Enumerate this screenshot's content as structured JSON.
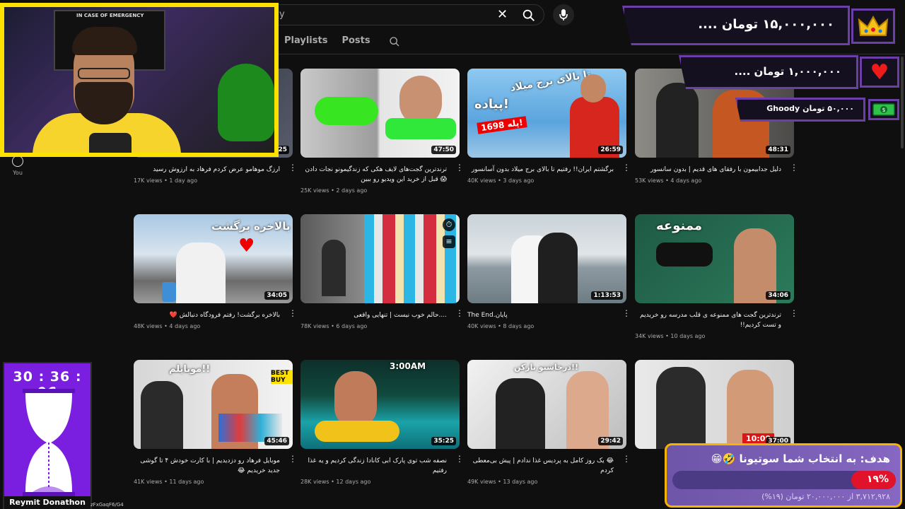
{
  "search": {
    "query": "y"
  },
  "tabs": [
    "Playlists",
    "Posts"
  ],
  "sidebar": {
    "you_label": "You"
  },
  "videos": [
    {
      "title": "ارزگ موهامو عرض کردم فرهاد به ارزوش رسید",
      "views": "17K views",
      "age": "1 day ago",
      "duration": "25",
      "rtl": true
    },
    {
      "title": "ترندترین گجت‌های لایف هکی که زندگیمونو نجات دادن 😱 قبل از خرید این ویدیو رو ببین",
      "views": "25K views",
      "age": "2 days ago",
      "duration": "47:50",
      "rtl": true
    },
    {
      "title": "برگشتم ایران!! رفتیم تا بالای برج میلاد بدون آسانسور",
      "views": "40K views",
      "age": "3 days ago",
      "duration": "26:59",
      "rtl": true
    },
    {
      "title": "دلیل جدابیمون با رفقای های قدیم | بدون سانسور",
      "views": "53K views",
      "age": "4 days ago",
      "duration": "48:31",
      "rtl": true
    },
    {
      "title": "بالاخره برگشت! رفتم فرودگاه دنبالش ❤️",
      "views": "48K views",
      "age": "4 days ago",
      "duration": "34:05",
      "rtl": true
    },
    {
      "title": "....حالم خوب نیست | تنهایی واقعی",
      "views": "78K views",
      "age": "6 days ago",
      "duration": "",
      "rtl": true
    },
    {
      "title": "The End.پایان",
      "views": "40K views",
      "age": "8 days ago",
      "duration": "1:13:53",
      "rtl": false
    },
    {
      "title": "ترندترین گجت های ممنوعه ی قلب مدرسه رو خریدیم و تست کردیم!!",
      "views": "34K views",
      "age": "10 days ago",
      "duration": "34:06",
      "rtl": true
    },
    {
      "title": "موبایل فرهاد رو دزدیدیم | با کارت خودش ۴ تا گوشی جدید خریدیم 😂",
      "views": "41K views",
      "age": "11 days ago",
      "duration": "45:46",
      "rtl": true
    },
    {
      "title": "نصفه شب توی پارک ابی کانادا زندگی کردیم و یه غذا رفتیم",
      "views": "28K views",
      "age": "12 days ago",
      "duration": "35:25",
      "rtl": true
    },
    {
      "title": "😂 یک روز کامل به پردیس غذا ندادم | پیش بی‌معطی کردم",
      "views": "49K views",
      "age": "13 days ago",
      "duration": "29:42",
      "rtl": true
    },
    {
      "title": "یه بیدار شه",
      "views": "",
      "age": "",
      "duration": "37:00",
      "rtl": true
    }
  ],
  "thumb_texts": {
    "v3_top": "تا بالای برج میلاد",
    "v3_mid": "پیاده!",
    "v3_num": "1698 پله!",
    "v5": "بالاخره برگشت",
    "v8": "ممنوعه",
    "v9_a": "موبایلم!!",
    "v9_b": "BEST BUY",
    "v10": "3:00AM",
    "v11": "درخاشنو بازکن!!",
    "v12": "10:00"
  },
  "webcam": {
    "poster_text": "IN CASE OF EMERGENCY"
  },
  "donations": [
    {
      "amount": "۱۵,۰۰۰,۰۰۰ تومان",
      "name": "....",
      "icon": "crown-icon"
    },
    {
      "amount": "۱,۰۰۰,۰۰۰ تومان",
      "name": "....",
      "icon": "heart-icon"
    },
    {
      "amount": "۵۰,۰۰۰ تومان",
      "name": "Ghoody",
      "icon": "money-icon"
    }
  ],
  "timer": {
    "time": "30 : 36 : 06",
    "caption": "Reymit Donathon",
    "url_fragment": "zFxGaqF6/G4"
  },
  "goal": {
    "title": "هدف: به انتخاب شما سوتیونا 🤣😁",
    "percent_label": "۱۹%",
    "progress": 0.19,
    "summary": "۳,۷۱۲,۹۲۸ از ۲۰,۰۰۰,۰۰۰ تومان (۱۹%)"
  },
  "colors": {
    "accent_purple": "#6b3ea8",
    "goal_border": "#f4b400",
    "progress_red": "#e0132a",
    "webcam_border": "#ffe100"
  }
}
